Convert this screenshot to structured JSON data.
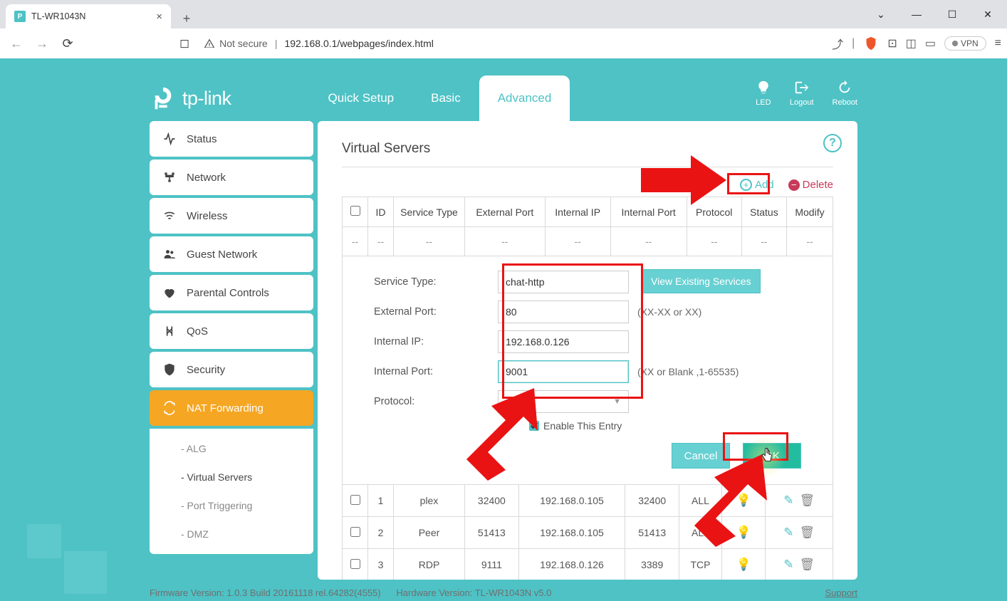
{
  "browser": {
    "tab_title": "TL-WR1043N",
    "not_secure": "Not secure",
    "url": "192.168.0.1/webpages/index.html",
    "vpn": "VPN"
  },
  "logo": "tp-link",
  "top_tabs": {
    "quick": "Quick Setup",
    "basic": "Basic",
    "advanced": "Advanced"
  },
  "top_actions": {
    "led": "LED",
    "logout": "Logout",
    "reboot": "Reboot"
  },
  "sidebar": {
    "items": [
      {
        "label": "Status"
      },
      {
        "label": "Network"
      },
      {
        "label": "Wireless"
      },
      {
        "label": "Guest Network"
      },
      {
        "label": "Parental Controls"
      },
      {
        "label": "QoS"
      },
      {
        "label": "Security"
      },
      {
        "label": "NAT Forwarding"
      }
    ],
    "subitems": [
      {
        "label": "- ALG"
      },
      {
        "label": "- Virtual Servers"
      },
      {
        "label": "- Port Triggering"
      },
      {
        "label": "- DMZ"
      }
    ]
  },
  "main": {
    "title": "Virtual Servers",
    "add": "Add",
    "delete": "Delete",
    "headers": {
      "id": "ID",
      "service": "Service Type",
      "ext": "External Port",
      "ip": "Internal IP",
      "iport": "Internal Port",
      "proto": "Protocol",
      "status": "Status",
      "modify": "Modify"
    },
    "form": {
      "service_label": "Service Type:",
      "service_value": "chat-http",
      "ext_label": "External Port:",
      "ext_value": "80",
      "ext_hint": "(XX-XX or XX)",
      "ip_label": "Internal IP:",
      "ip_value": "192.168.0.126",
      "iport_label": "Internal Port:",
      "iport_value": "9001",
      "iport_hint": "(XX or Blank ,1-65535)",
      "proto_label": "Protocol:",
      "proto_value": "ALL",
      "view_btn": "View Existing Services",
      "enable": "Enable This Entry",
      "cancel": "Cancel",
      "ok": "OK"
    },
    "rows": [
      {
        "id": "1",
        "service": "plex",
        "ext": "32400",
        "ip": "192.168.0.105",
        "iport": "32400",
        "proto": "ALL"
      },
      {
        "id": "2",
        "service": "Peer",
        "ext": "51413",
        "ip": "192.168.0.105",
        "iport": "51413",
        "proto": "ALL"
      },
      {
        "id": "3",
        "service": "RDP",
        "ext": "9111",
        "ip": "192.168.0.126",
        "iport": "3389",
        "proto": "TCP"
      }
    ]
  },
  "footer": {
    "fw": "Firmware Version: 1.0.3 Build 20161118 rel.64282(4555)",
    "hw": "Hardware Version: TL-WR1043N v5.0",
    "support": "Support"
  }
}
